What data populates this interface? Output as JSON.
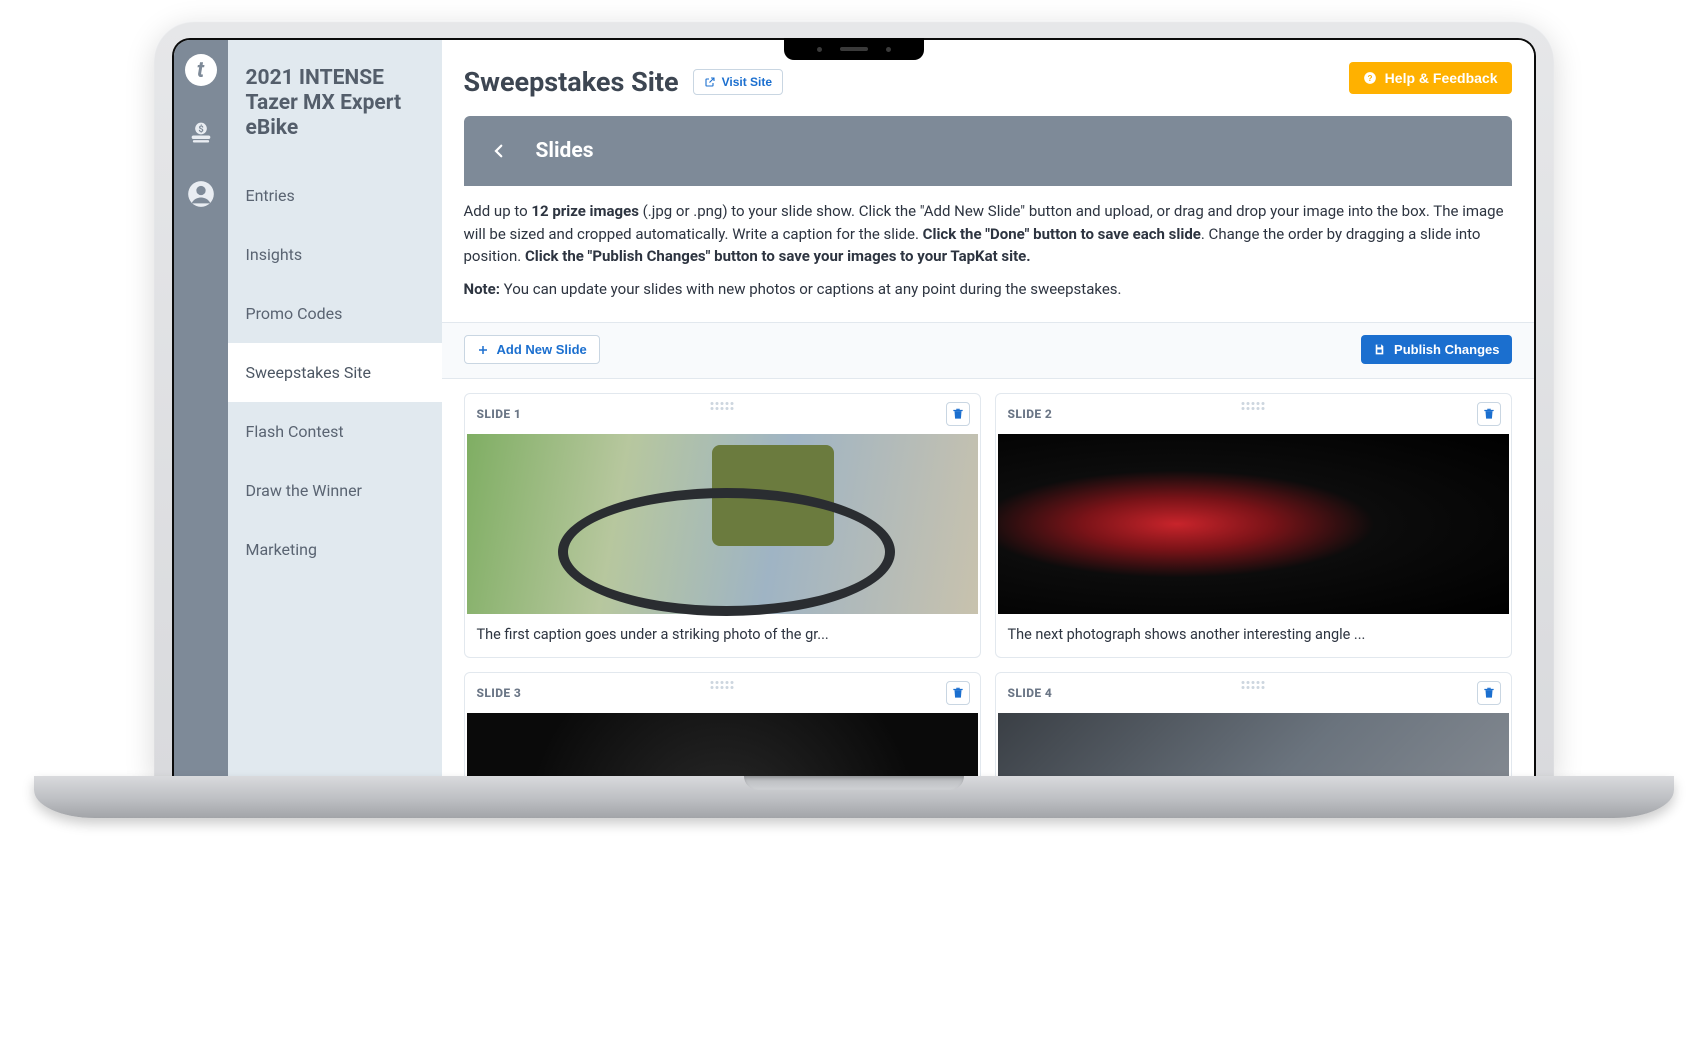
{
  "sidebar": {
    "title": "2021 INTENSE Tazer MX Expert eBike",
    "items": [
      {
        "label": "Entries"
      },
      {
        "label": "Insights"
      },
      {
        "label": "Promo Codes"
      },
      {
        "label": "Sweepstakes Site",
        "active": true
      },
      {
        "label": "Flash Contest"
      },
      {
        "label": "Draw the Winner"
      },
      {
        "label": "Marketing"
      }
    ]
  },
  "header": {
    "page_title": "Sweepstakes Site",
    "visit_site": "Visit Site",
    "help_feedback": "Help & Feedback"
  },
  "section": {
    "title": "Slides"
  },
  "instructions": {
    "intro_prefix": "Add up to ",
    "intro_bold1": "12 prize images",
    "intro_mid1": " (.jpg or .png) to your slide show. Click the \"Add New Slide\" button and upload, or drag and drop your image into the box. The image will be sized and cropped automatically. Write a caption for the slide. ",
    "intro_bold2": "Click the \"Done\" button to save each slide",
    "intro_mid2": ". Change the order by dragging a slide into position. ",
    "intro_bold3": "Click the \"Publish Changes\" button to save your images to your TapKat site.",
    "note_label": "Note:",
    "note_text": " You can update your slides with new photos or captions at any point during the sweepstakes."
  },
  "actions": {
    "add_slide": "Add New Slide",
    "publish": "Publish Changes"
  },
  "slides": [
    {
      "label": "SLIDE 1",
      "caption": "The first caption goes under a striking photo of the gr..."
    },
    {
      "label": "SLIDE 2",
      "caption": "The next photograph shows another interesting angle ..."
    },
    {
      "label": "SLIDE 3",
      "caption": ""
    },
    {
      "label": "SLIDE 4",
      "caption": ""
    }
  ]
}
